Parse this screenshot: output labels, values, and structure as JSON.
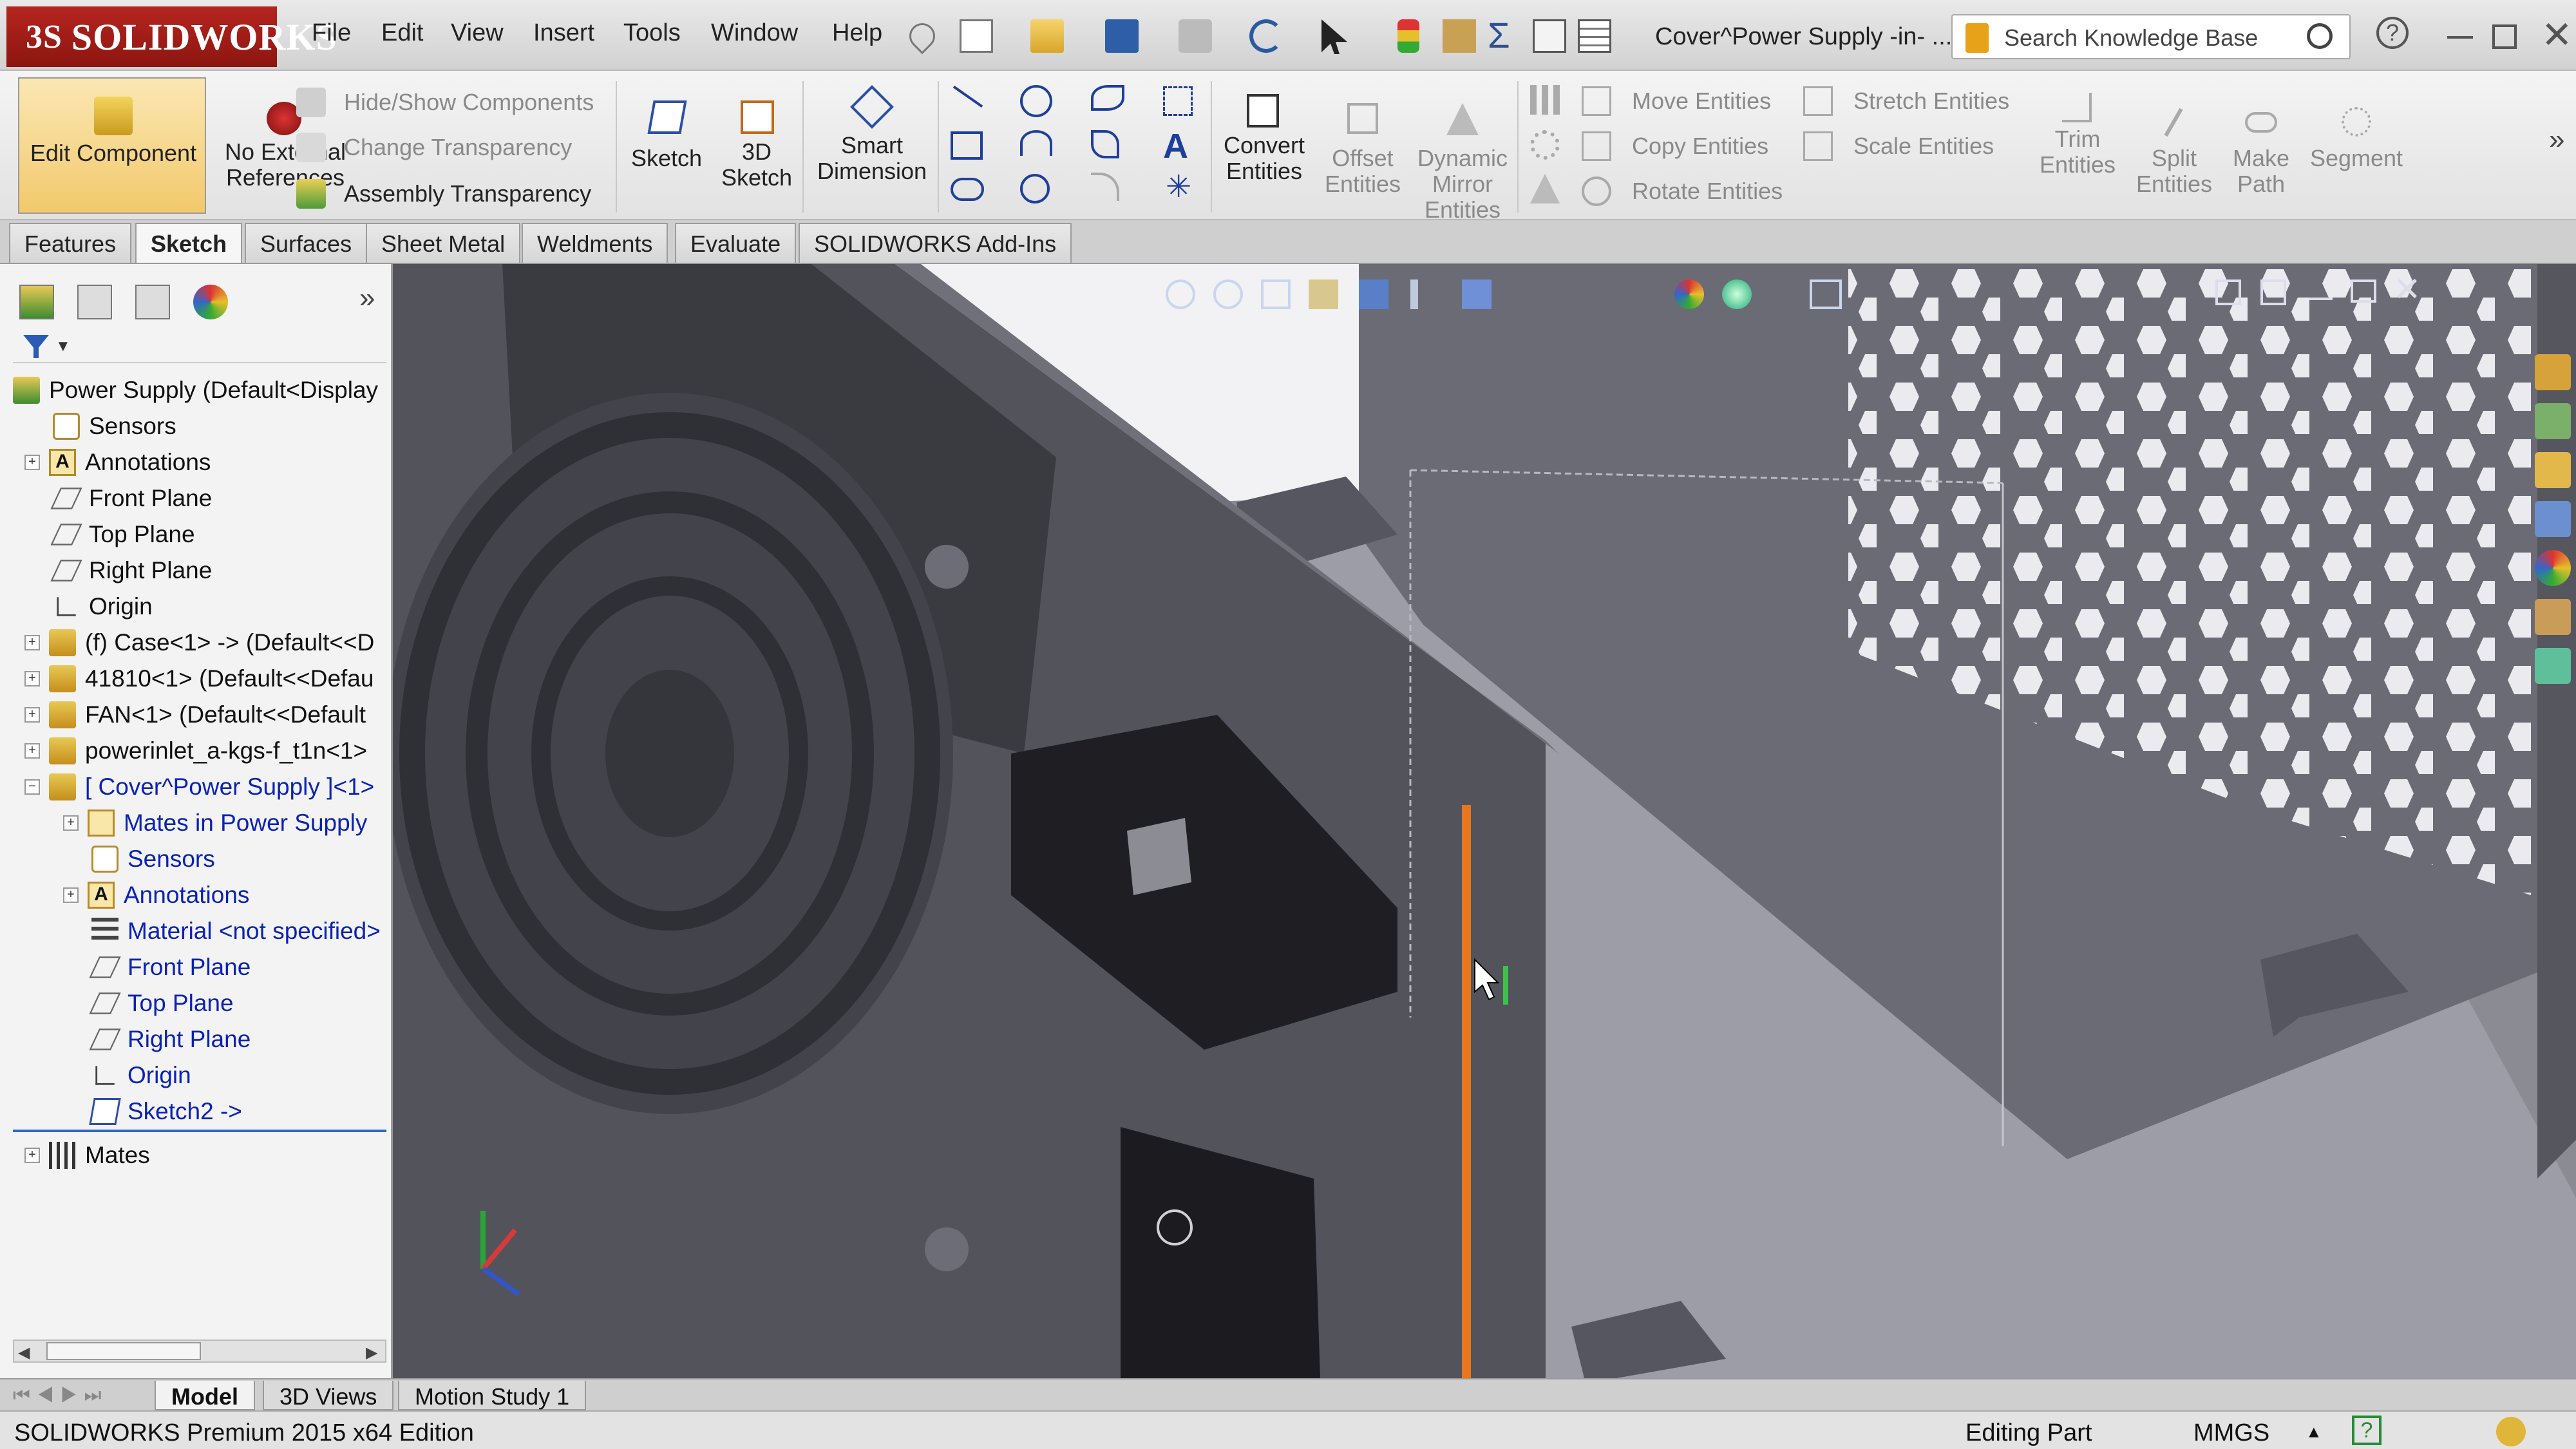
{
  "app": {
    "logo_text": "SOLIDWORKS",
    "logo_prefix": "3S",
    "document_title": "Cover^Power Supply -in- ..."
  },
  "menu": [
    "File",
    "Edit",
    "View",
    "Insert",
    "Tools",
    "Window",
    "Help"
  ],
  "search": {
    "placeholder": "Search Knowledge Base"
  },
  "command_manager": {
    "edit_component": "Edit Component",
    "no_external_references": "No External References",
    "hide_show_components": "Hide/Show Components",
    "change_transparency": "Change Transparency",
    "assembly_transparency": "Assembly Transparency",
    "sketch": "Sketch",
    "sketch_3d": "3D Sketch",
    "smart_dimension": "Smart Dimension",
    "convert_entities": "Convert Entities",
    "offset_entities": "Offset Entities",
    "dynamic_mirror_entities": "Dynamic Mirror Entities",
    "move_entities": "Move Entities",
    "copy_entities": "Copy Entities",
    "rotate_entities": "Rotate Entities",
    "stretch_entities": "Stretch Entities",
    "scale_entities": "Scale Entities",
    "trim_entities": "Trim Entities",
    "split_entities": "Split Entities",
    "make_path": "Make Path",
    "segment": "Segment"
  },
  "tabs": [
    "Features",
    "Sketch",
    "Surfaces",
    "Sheet Metal",
    "Weldments",
    "Evaluate",
    "SOLIDWORKS Add-Ins"
  ],
  "active_tab": "Sketch",
  "feature_tree": {
    "root": "Power Supply  (Default<Display",
    "items": [
      {
        "label": "Sensors"
      },
      {
        "label": "Annotations"
      },
      {
        "label": "Front Plane"
      },
      {
        "label": "Top Plane"
      },
      {
        "label": "Right Plane"
      },
      {
        "label": "Origin"
      },
      {
        "label": "(f) Case<1> -> (Default<<D"
      },
      {
        "label": "41810<1> (Default<<Defau"
      },
      {
        "label": "FAN<1> (Default<<Default"
      },
      {
        "label": "powerinlet_a-kgs-f_t1n<1>"
      },
      {
        "label": "[ Cover^Power Supply ]<1>"
      },
      {
        "label": "Mates in Power Supply"
      },
      {
        "label": "Sensors"
      },
      {
        "label": "Annotations"
      },
      {
        "label": "Material <not specified>"
      },
      {
        "label": "Front Plane"
      },
      {
        "label": "Top Plane"
      },
      {
        "label": "Right Plane"
      },
      {
        "label": "Origin"
      },
      {
        "label": "Sketch2 ->"
      },
      {
        "label": "Mates"
      }
    ]
  },
  "bottom_tabs": [
    "Model",
    "3D Views",
    "Motion Study 1"
  ],
  "status": {
    "edition": "SOLIDWORKS Premium 2015 x64 Edition",
    "mode": "Editing Part",
    "units": "MMGS"
  },
  "colors": {
    "logo_red": "#a81e18",
    "tree_blue": "#0b22b5",
    "edge_highlight": "#e8761c",
    "viewport": "#7c7d85"
  }
}
